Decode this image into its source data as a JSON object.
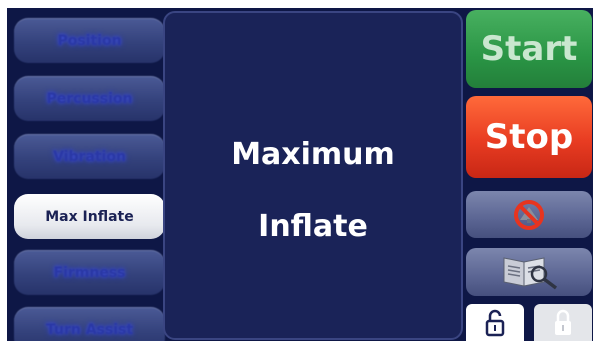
{
  "menu": {
    "items": [
      {
        "label": "Position",
        "state": "disabled"
      },
      {
        "label": "Percussion",
        "state": "disabled"
      },
      {
        "label": "Vibration",
        "state": "disabled"
      },
      {
        "label": "Max Inflate",
        "state": "selected"
      },
      {
        "label": "Firmness",
        "state": "disabled"
      },
      {
        "label": "Turn Assist",
        "state": "disabled"
      }
    ]
  },
  "display": {
    "line1": "Maximum",
    "line2": "Inflate"
  },
  "controls": {
    "start_label": "Start",
    "stop_label": "Stop",
    "start_color": "#2a9545",
    "stop_color": "#e83c22"
  },
  "icons": {
    "no_silence": "no-symbol-icon",
    "manual": "manual-book-icon",
    "unlock": "unlocked-padlock-icon",
    "lock": "locked-padlock-icon"
  }
}
